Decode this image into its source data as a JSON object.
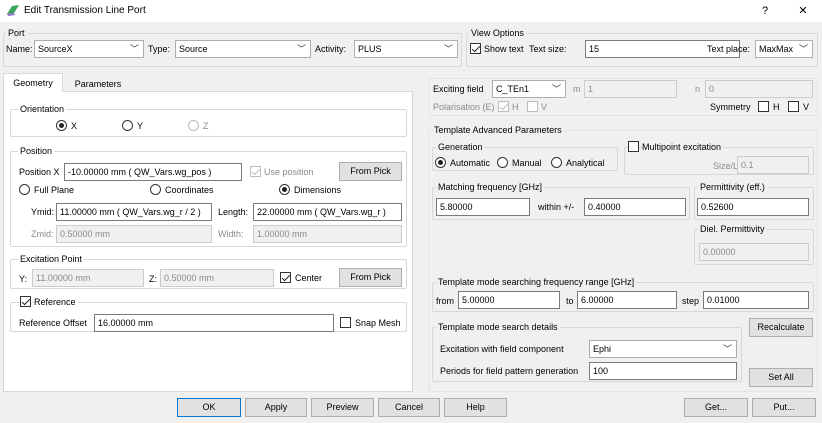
{
  "window": {
    "title": "Edit Transmission Line Port",
    "help_label": "?",
    "close_label": "✕"
  },
  "port": {
    "group_label": "Port",
    "name_label": "Name:",
    "name_value": "SourceX",
    "type_label": "Type:",
    "type_value": "Source",
    "activity_label": "Activity:",
    "activity_value": "PLUS"
  },
  "view_options": {
    "group_label": "View Options",
    "show_text_label": "Show text",
    "show_text_checked": true,
    "text_size_label": "Text size:",
    "text_size_value": "15",
    "text_place_label": "Text place:",
    "text_place_value": "MaxMax"
  },
  "tabs": [
    {
      "label": "Geometry",
      "active": true
    },
    {
      "label": "Parameters",
      "active": false
    }
  ],
  "orientation": {
    "group_label": "Orientation",
    "options": [
      "X",
      "Y",
      "Z"
    ],
    "selected": "X"
  },
  "position": {
    "group_label": "Position",
    "position_x_label": "Position X",
    "position_x_value": "-10.00000 mm  ( QW_Vars.wg_pos )",
    "use_position_label": "Use position",
    "from_pick_label": "From Pick",
    "modes": [
      "Full Plane",
      "Coordinates",
      "Dimensions"
    ],
    "selected_mode": "Dimensions",
    "ymid_label": "Ymid:",
    "ymid_value": "11.00000 mm  ( QW_Vars.wg_r / 2 )",
    "length_label": "Length:",
    "length_value": "22.00000 mm  ( QW_Vars.wg_r )",
    "zmid_label": "Zmid:",
    "zmid_value": "0.50000 mm",
    "width_label": "Width:",
    "width_value": "1.00000 mm"
  },
  "excitation_point": {
    "group_label": "Excitation Point",
    "y_label": "Y:",
    "y_value": "11.00000 mm",
    "z_label": "Z:",
    "z_value": "0.50000 mm",
    "center_label": "Center",
    "center_checked": true,
    "from_pick_label": "From Pick"
  },
  "reference": {
    "label": "Reference",
    "checked": true,
    "offset_label": "Reference Offset",
    "offset_value": "16.00000 mm",
    "snap_mesh_label": "Snap Mesh"
  },
  "exciting": {
    "exciting_field_label": "Exciting field",
    "exciting_field_value": "C_TEn1",
    "m_label": "m",
    "m_value": "1",
    "n_label": "n",
    "n_value": "0",
    "polarisation_label": "Polarisation (E)",
    "h_label": "H",
    "v_label": "V",
    "symmetry_label": "Symmetry",
    "sym_h_label": "H",
    "sym_v_label": "V"
  },
  "template_advanced": {
    "group_label": "Template Advanced Parameters",
    "generation_label": "Generation",
    "generation_options": [
      "Automatic",
      "Manual",
      "Analytical"
    ],
    "generation_selected": "Automatic",
    "multipoint_label": "Multipoint excitation",
    "size_label": "Size/L",
    "size_value": "0.1",
    "matching_freq_label": "Matching frequency [GHz]",
    "matching_freq_value": "5.80000",
    "within_label": "within +/-",
    "within_value": "0.40000",
    "permittivity_label": "Permittivity (eff.)",
    "permittivity_value": "0.52600",
    "diel_label": "Diel. Permittivity",
    "diel_value": "0.00000"
  },
  "search_range": {
    "group_label": "Template mode searching frequency range [GHz]",
    "from_label": "from",
    "from_value": "5.00000",
    "to_label": "to",
    "to_value": "6.00000",
    "step_label": "step",
    "step_value": "0.01000"
  },
  "search_details": {
    "group_label": "Template mode search details",
    "recalculate_label": "Recalculate",
    "excitation_label": "Excitation with field component",
    "excitation_value": "Ephi",
    "periods_label": "Periods for field pattern generation",
    "periods_value": "100",
    "set_all_label": "Set All"
  },
  "footer": {
    "ok": "OK",
    "apply": "Apply",
    "preview": "Preview",
    "cancel": "Cancel",
    "help": "Help",
    "get": "Get...",
    "put": "Put..."
  }
}
